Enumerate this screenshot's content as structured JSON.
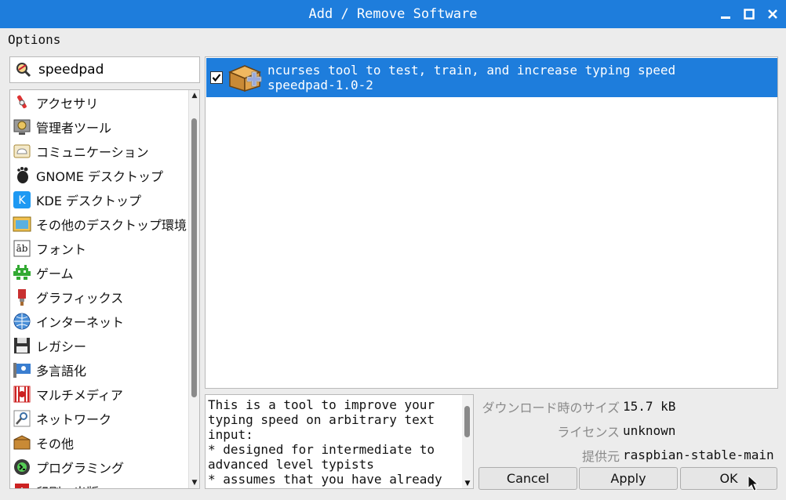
{
  "window": {
    "title": "Add / Remove Software"
  },
  "menubar": {
    "options": "Options"
  },
  "search": {
    "value": "speedpad"
  },
  "categories": [
    {
      "label": "アクセサリ",
      "icon": "accessories-icon"
    },
    {
      "label": "管理者ツール",
      "icon": "admin-tools-icon"
    },
    {
      "label": "コミュニケーション",
      "icon": "communication-icon"
    },
    {
      "label": "GNOME デスクトップ",
      "icon": "gnome-icon"
    },
    {
      "label": "KDE デスクトップ",
      "icon": "kde-icon"
    },
    {
      "label": "その他のデスクトップ環境",
      "icon": "other-desktop-icon"
    },
    {
      "label": "フォント",
      "icon": "fonts-icon"
    },
    {
      "label": "ゲーム",
      "icon": "games-icon"
    },
    {
      "label": "グラフィックス",
      "icon": "graphics-icon"
    },
    {
      "label": "インターネット",
      "icon": "internet-icon"
    },
    {
      "label": "レガシー",
      "icon": "legacy-icon"
    },
    {
      "label": "多言語化",
      "icon": "localization-icon"
    },
    {
      "label": "マルチメディア",
      "icon": "multimedia-icon"
    },
    {
      "label": "ネットワーク",
      "icon": "network-icon"
    },
    {
      "label": "その他",
      "icon": "other-icon"
    },
    {
      "label": "プログラミング",
      "icon": "programming-icon"
    },
    {
      "label": "印刷・出版",
      "icon": "publishing-icon"
    }
  ],
  "package": {
    "summary": "ncurses tool to test, train, and increase typing speed",
    "name": "speedpad-1.0-2",
    "checked": true
  },
  "description": "This is a tool to improve your typing speed on arbitrary text input:\n* designed for intermediate to advanced level typists\n* assumes that you have already",
  "details": {
    "download_size_label": "ダウンロード時のサイズ",
    "download_size_value": "15.7 kB",
    "license_label": "ライセンス",
    "license_value": "unknown",
    "source_label": "提供元",
    "source_value": "raspbian-stable-main"
  },
  "buttons": {
    "cancel": "Cancel",
    "apply": "Apply",
    "ok": "OK"
  },
  "colors": {
    "accent": "#1e7ddc",
    "window_bg": "#ececec"
  }
}
